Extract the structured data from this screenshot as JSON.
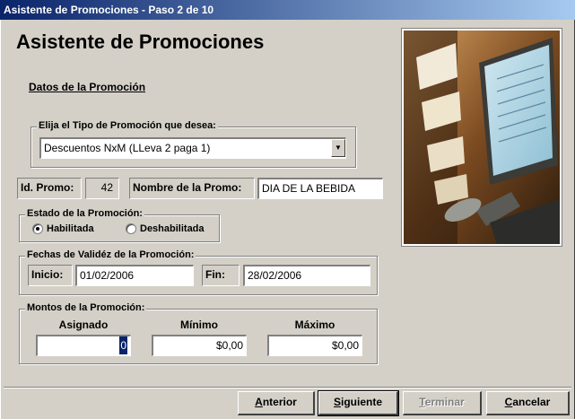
{
  "window": {
    "title": "Asistente de Promociones - Paso 2 de 10"
  },
  "header": {
    "title": "Asistente de Promociones",
    "section": "Datos de la Promoción"
  },
  "tipo": {
    "legend": "Elija el Tipo de Promoción que desea:",
    "selected": "Descuentos NxM (LLeva 2 paga 1)"
  },
  "promo": {
    "id_label": "Id. Promo:",
    "id_value": "42",
    "nombre_label": "Nombre de la Promo:",
    "nombre_value": "DIA DE LA BEBIDA"
  },
  "estado": {
    "legend": "Estado de la Promoción:",
    "options": [
      "Habilitada",
      "Deshabilitada"
    ],
    "selected": "Habilitada"
  },
  "fechas": {
    "legend": "Fechas de Validéz de la Promoción:",
    "inicio_label": "Inicio:",
    "inicio_value": "01/02/2006",
    "fin_label": "Fin:",
    "fin_value": "28/02/2006"
  },
  "montos": {
    "legend": "Montos de la Promoción:",
    "asignado_label": "Asignado",
    "asignado_value": "0",
    "minimo_label": "Mínimo",
    "minimo_value": "$0,00",
    "maximo_label": "Máximo",
    "maximo_value": "$0,00"
  },
  "buttons": {
    "anterior": {
      "first": "A",
      "rest": "nterior"
    },
    "siguiente": {
      "first": "S",
      "rest": "iguiente"
    },
    "terminar": {
      "first": "T",
      "rest": "erminar"
    },
    "cancelar": {
      "first": "C",
      "rest": "ancelar"
    }
  },
  "icons": {
    "combo_arrow": "chevron-down-icon",
    "photo": "barcode-scanner-photo"
  }
}
